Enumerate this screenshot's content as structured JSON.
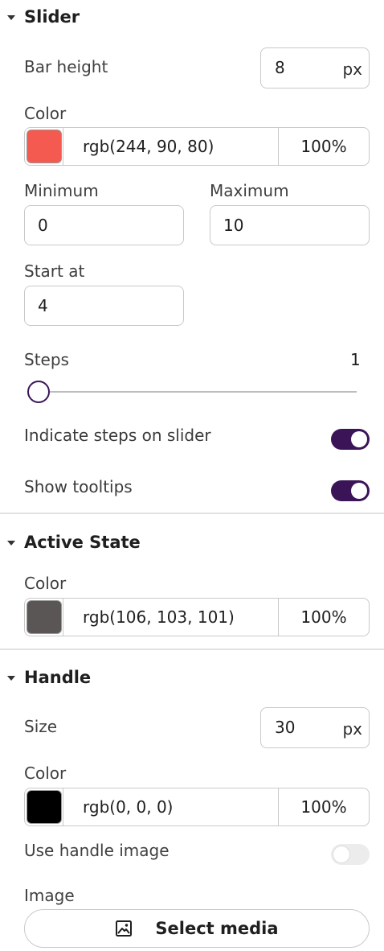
{
  "slider": {
    "title": "Slider",
    "bar_height": {
      "label": "Bar height",
      "value": "8",
      "unit": "px"
    },
    "color": {
      "label": "Color",
      "hex": "#f45a50",
      "value": "rgb(244, 90, 80)",
      "alpha": "100%"
    },
    "minimum": {
      "label": "Minimum",
      "value": "0"
    },
    "maximum": {
      "label": "Maximum",
      "value": "10"
    },
    "start_at": {
      "label": "Start at",
      "value": "4"
    },
    "steps": {
      "label": "Steps",
      "value": "1",
      "fraction": 0.0
    },
    "indicate_steps": {
      "label": "Indicate steps on slider",
      "on": true
    },
    "show_tooltips": {
      "label": "Show tooltips",
      "on": true
    }
  },
  "active_state": {
    "title": "Active State",
    "color": {
      "label": "Color",
      "hex": "#5a5655",
      "value": "rgb(106, 103, 101)",
      "alpha": "100%"
    }
  },
  "handle": {
    "title": "Handle",
    "size": {
      "label": "Size",
      "value": "30",
      "unit": "px"
    },
    "color": {
      "label": "Color",
      "hex": "#000000",
      "value": "rgb(0, 0, 0)",
      "alpha": "100%"
    },
    "use_image": {
      "label": "Use handle image",
      "on": false
    },
    "image": {
      "label": "Image",
      "button": "Select media",
      "icon": "image-icon"
    }
  },
  "accent": "#3b1457"
}
